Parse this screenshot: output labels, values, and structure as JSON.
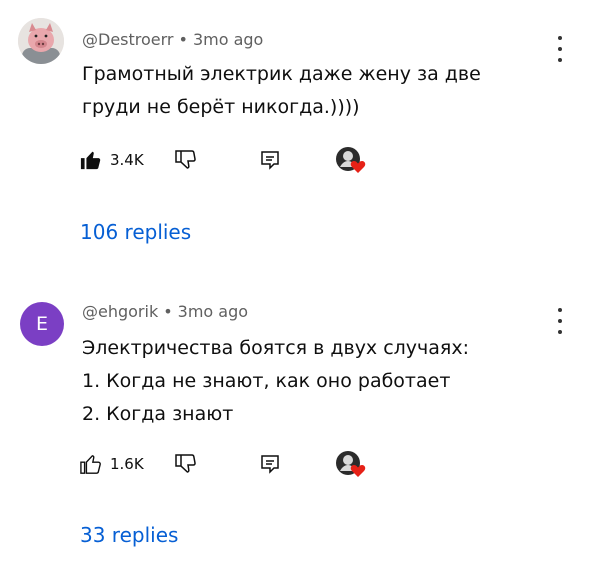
{
  "comments": [
    {
      "handle": "@Destroerr",
      "time": "3mo ago",
      "text_lines": [
        "Грамотный электрик даже жену за две",
        "груди не берёт никогда.))))"
      ],
      "likes": "3.4K",
      "replies": "106 replies",
      "avatar_icon": "pig-avatar-icon"
    },
    {
      "handle": "@ehgorik",
      "time": "3mo ago",
      "avatar_letter": "E",
      "text_lines": [
        "Электричества боятся в двух случаях:",
        "1. Когда не знают, как оно работает",
        "2. Когда знают"
      ],
      "likes": "1.6K",
      "replies": "33 replies"
    }
  ],
  "separator": "•",
  "colors": {
    "link": "#065fd4",
    "heart": "#e62117",
    "avatar_e": "#7b3fc4",
    "meta": "#606060"
  }
}
